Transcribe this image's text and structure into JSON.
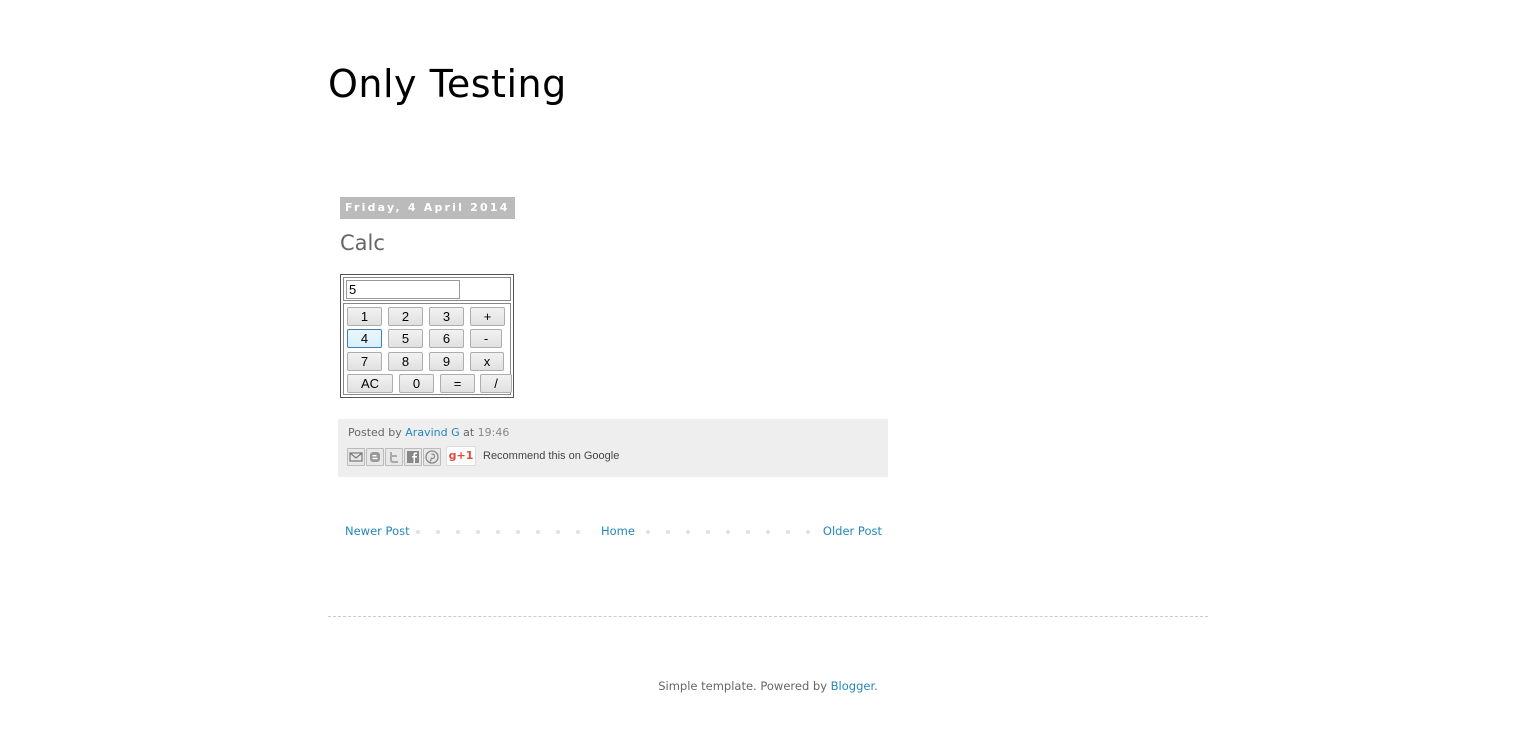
{
  "blog": {
    "title": "Only Testing"
  },
  "post": {
    "date": "Friday, 4 April 2014",
    "title": "Calc",
    "calculator": {
      "display_value": "5",
      "keys": [
        "1",
        "2",
        "3",
        "+",
        "4",
        "5",
        "6",
        "-",
        "7",
        "8",
        "9",
        "x",
        "AC",
        "0",
        "=",
        "/"
      ],
      "hovered_key": "4"
    },
    "footer": {
      "posted_by_label": "Posted by",
      "author": "Aravind G",
      "at_label": "at",
      "time": "19:46",
      "share_icons": [
        "email-icon",
        "blogger-icon",
        "twitter-icon",
        "facebook-icon",
        "pinterest-icon"
      ],
      "gplus_label": "g+1",
      "recommend_text": "Recommend this on Google"
    }
  },
  "pager": {
    "newer": "Newer Post",
    "home": "Home",
    "older": "Older Post"
  },
  "attribution": {
    "prefix": "Simple template. Powered by ",
    "link": "Blogger",
    "suffix": "."
  },
  "colors": {
    "link": "#2288bb",
    "date_header_bg": "#bbbbbb",
    "post_footer_bg": "#eeeeee"
  }
}
